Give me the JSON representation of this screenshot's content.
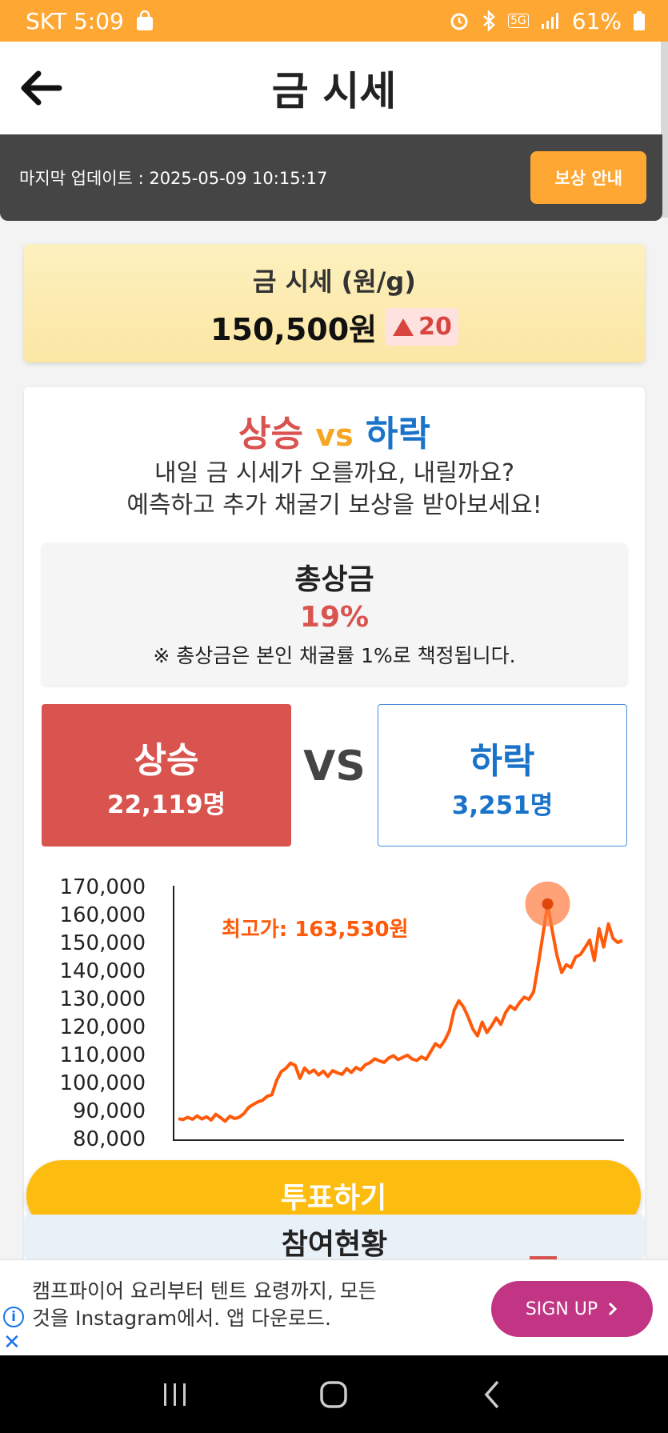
{
  "status_bar": {
    "carrier_time": "SKT 5:09",
    "network": "5G",
    "battery": "61%"
  },
  "app_bar": {
    "title": "금 시세",
    "back_icon": "arrow-left-icon"
  },
  "update_bar": {
    "last_update": "마지막 업데이트 : 2025-05-09 10:15:17",
    "reward_button": "보상 안내"
  },
  "price_card": {
    "label": "금 시세 (원/g)",
    "price": "150,500원",
    "change": "20",
    "change_direction": "up"
  },
  "vote_section": {
    "title_up": "상승",
    "title_vs": "vs",
    "title_down": "하락",
    "desc_line1": "내일 금 시세가 오를까요, 내릴까요?",
    "desc_line2": "예측하고 추가 채굴기 보상을 받아보세요!",
    "prize": {
      "title": "총상금",
      "value": "19%",
      "note": "※ 총상금은 본인 채굴률 1%로 책정됩니다."
    },
    "up": {
      "label": "상승",
      "count": "22,119명"
    },
    "vs_big": "VS",
    "down": {
      "label": "하락",
      "count": "3,251명"
    }
  },
  "chart_data": {
    "type": "line",
    "series": [
      {
        "values": [
          86800,
          86500,
          87300,
          86600,
          87800,
          86700,
          87500,
          86300,
          88400,
          87200,
          85900,
          87700,
          86900,
          87300,
          88600,
          90800,
          91900,
          92800,
          93400,
          94800,
          95300,
          100400,
          103600,
          104800,
          106700,
          105800,
          101200,
          104900,
          103100,
          104200,
          102400,
          103800,
          101900,
          104000,
          103200,
          102600,
          104700,
          103300,
          105100,
          104200,
          106100,
          106800,
          108200,
          107500,
          106900,
          108500,
          109300,
          107900,
          108700,
          109500,
          108100,
          107600,
          108900,
          108000,
          110800,
          113600,
          112400,
          114800,
          118200,
          125600,
          128900,
          126700,
          123100,
          118800,
          116400,
          121300,
          117600,
          119900,
          122800,
          120500,
          124700,
          127100,
          125800,
          128300,
          130200,
          129400,
          132100,
          141800,
          152600,
          163500,
          153800,
          145100,
          139000,
          141800,
          140800,
          144600,
          145400,
          147900,
          150600,
          143300,
          154700,
          148100,
          156400,
          151200,
          149700,
          150500
        ]
      }
    ],
    "ylim": [
      80000,
      170000
    ],
    "yticks": [
      "170,000",
      "160,000",
      "150,000",
      "140,000",
      "130,000",
      "120,000",
      "110,000",
      "100,000",
      "90,000",
      "80,000"
    ],
    "annotation": "최고가: 163,530원",
    "peak_index": 79,
    "grid": false,
    "line_color": "#ff5a0a",
    "marker_color": "#ff7a3d"
  },
  "vote_button": {
    "label": "투표하기"
  },
  "participation": {
    "label": "참여현황"
  },
  "ad": {
    "text_line1": "캠프파이어 요리부터 텐트 요령까지, 모든",
    "text_line2": "것을 Instagram에서. 앱 다운로드.",
    "cta": "SIGN UP"
  },
  "colors": {
    "accent_orange": "#ffa733",
    "up_red": "#d9534f",
    "down_blue": "#1a73c8",
    "vote_yellow": "#fdbd10",
    "ad_purple": "#c13584"
  }
}
